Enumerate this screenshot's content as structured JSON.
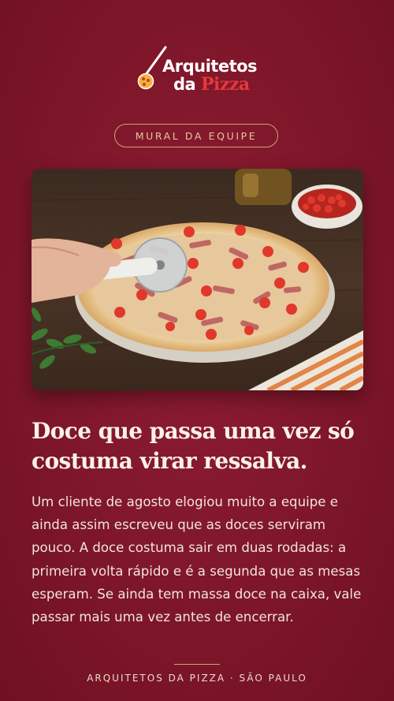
{
  "brand": {
    "name_line1": "Arquitetos",
    "name_line2_prefix": "da",
    "name_line2_accent": "Pizza"
  },
  "badge": "MURAL DA EQUIPE",
  "post": {
    "headline": "Doce que passa uma vez só costuma virar ressalva.",
    "body": "Um cliente de agosto elogiou muito a equipe e ainda assim escreveu que as doces serviram pouco. A doce costuma sair em duas rodadas: a primeira volta rápido e é a segunda que as mesas esperam. Se ainda tem massa doce na caixa, vale passar mais uma vez antes de encerrar."
  },
  "footer": "ARQUITETOS DA PIZZA · SÃO PAULO",
  "icons": [
    "pizza-peel-logo-icon"
  ],
  "colors": {
    "background": "#7e1629",
    "accent_gold": "#c9a577",
    "logo_red": "#e43a3a"
  }
}
